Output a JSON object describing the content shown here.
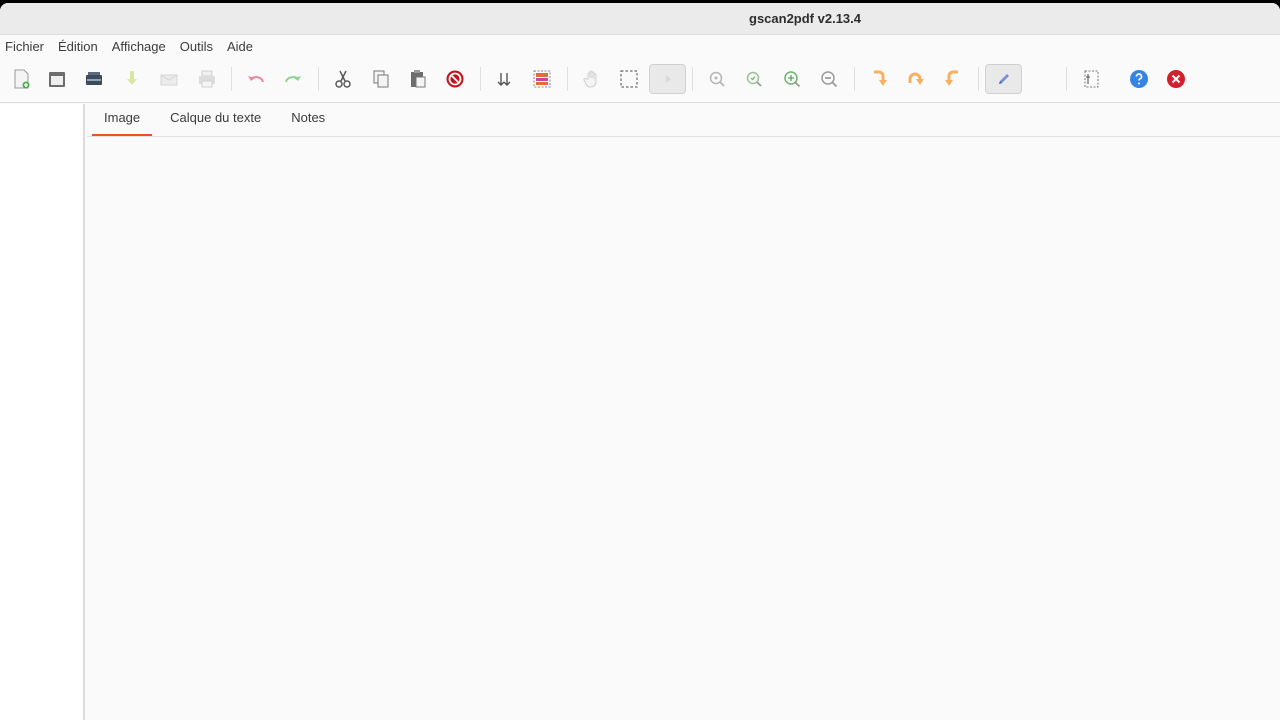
{
  "window": {
    "title": "gscan2pdf v2.13.4"
  },
  "menubar": {
    "items": [
      "Fichier",
      "Édition",
      "Affichage",
      "Outils",
      "Aide"
    ]
  },
  "toolbar": {
    "icons": [
      "new-document-icon",
      "open-icon",
      "scan-icon",
      "save-icon",
      "email-icon",
      "print-icon",
      "undo-icon",
      "redo-icon",
      "cut-icon",
      "copy-icon",
      "paste-icon",
      "delete-icon",
      "renumber-icon",
      "select-all-icon",
      "pan-icon",
      "select-rectangle-icon",
      "play-icon",
      "zoom-100-icon",
      "zoom-fit-icon",
      "zoom-in-icon",
      "zoom-out-icon",
      "rotate-90-icon",
      "rotate-180-icon",
      "rotate-270-icon",
      "edit-pen-icon",
      "crop-icon",
      "help-icon",
      "quit-icon"
    ]
  },
  "tabs": [
    "Image",
    "Calque du texte",
    "Notes"
  ],
  "colors": {
    "accent": "#e95420",
    "help": "#3584e4",
    "quit": "#d4202c",
    "undo": "#e0596d",
    "redo": "#73c872",
    "rotate": "#f5a742"
  }
}
